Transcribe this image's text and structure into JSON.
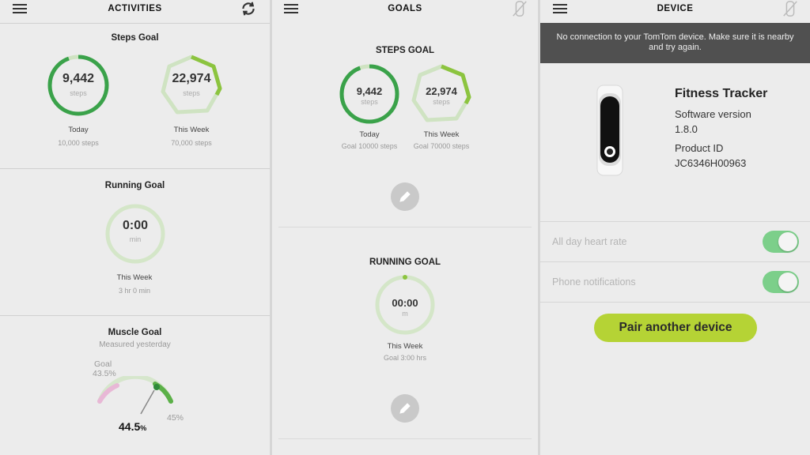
{
  "activities": {
    "title": "ACTIVITIES",
    "steps_goal": {
      "heading": "Steps Goal",
      "today": {
        "value": "9,442",
        "unit": "steps",
        "label": "Today",
        "goal": "10,000 steps",
        "progress": 0.944
      },
      "week": {
        "value": "22,974",
        "unit": "steps",
        "label": "This Week",
        "goal": "70,000 steps",
        "progress": 0.328
      }
    },
    "running_goal": {
      "heading": "Running Goal",
      "value": "0:00",
      "unit": "min",
      "label": "This Week",
      "goal": "3 hr 0 min",
      "progress": 0
    },
    "muscle_goal": {
      "heading": "Muscle Goal",
      "subtitle": "Measured yesterday",
      "goal_label": "Goal",
      "goal_value": "43.5%",
      "current_value": "44.5",
      "current_unit": "%",
      "max_label": "45%"
    }
  },
  "goals": {
    "title": "GOALS",
    "steps": {
      "heading": "STEPS GOAL",
      "today": {
        "value": "9,442",
        "unit": "steps",
        "label": "Today",
        "goal": "Goal 10000 steps",
        "progress": 0.944
      },
      "week": {
        "value": "22,974",
        "unit": "steps",
        "label": "This Week",
        "goal": "Goal 70000 steps",
        "progress": 0.328
      }
    },
    "running": {
      "heading": "RUNNING GOAL",
      "value": "00:00",
      "unit": "m",
      "label": "This Week",
      "goal": "Goal 3:00 hrs",
      "progress": 0
    }
  },
  "device": {
    "title": "DEVICE",
    "banner": "No connection to your TomTom device. Make sure it is nearby and try again.",
    "name": "Fitness Tracker",
    "software_label": "Software version",
    "software_version": "1.8.0",
    "product_label": "Product ID",
    "product_id": "JC6346H00963",
    "settings": [
      {
        "label": "All day heart rate",
        "enabled": true
      },
      {
        "label": "Phone notifications",
        "enabled": true
      }
    ],
    "pair_button": "Pair another device"
  },
  "colors": {
    "ring_track": "#cfe3c2",
    "ring_green": "#3aa24a",
    "ring_lime": "#8cc43f",
    "pair_button": "#b5d335",
    "toggle_on": "#7ccf8a",
    "banner_bg": "#505050"
  },
  "icons": {
    "menu": "hamburger-icon",
    "sync": "sync-icon",
    "no_device": "watch-disconnected-icon",
    "edit": "pencil-icon"
  }
}
